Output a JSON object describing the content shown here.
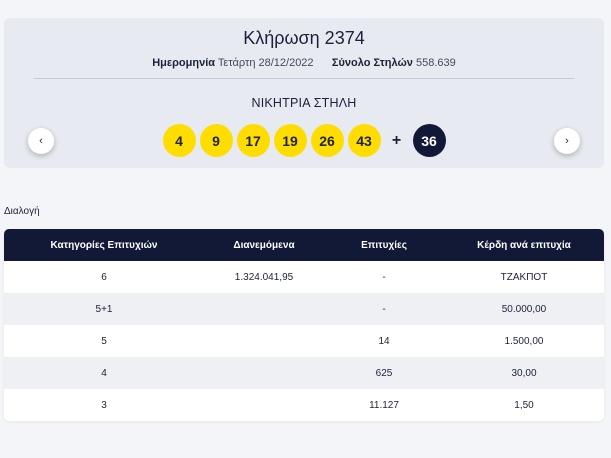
{
  "draw": {
    "title": "Κλήρωση 2374",
    "date_label": "Ημερομηνία",
    "date_value": "Τετάρτη 28/12/2022",
    "total_label": "Σύνολο Στηλών",
    "total_value": "558.639",
    "winning_label": "ΝΙΚΗΤΡΙΑ ΣΤΗΛΗ",
    "numbers": [
      "4",
      "9",
      "17",
      "19",
      "26",
      "43"
    ],
    "plus": "+",
    "joker": "36",
    "prev_icon": "‹",
    "next_icon": "›"
  },
  "select_label": "Διαλογή",
  "table": {
    "headers": [
      "Κατηγορίες Επιτυχιών",
      "Διανεμόμενα",
      "Επιτυχίες",
      "Κέρδη ανά επιτυχία"
    ],
    "rows": [
      [
        "6",
        "1.324.041,95",
        "-",
        "ΤΖΑΚΠΟΤ"
      ],
      [
        "5+1",
        "",
        "-",
        "50.000,00"
      ],
      [
        "5",
        "",
        "14",
        "1.500,00"
      ],
      [
        "4",
        "",
        "625",
        "30,00"
      ],
      [
        "3",
        "",
        "11.127",
        "1,50"
      ]
    ]
  },
  "colors": {
    "ball": "#ffdd00",
    "joker": "#111936",
    "header": "#111936"
  }
}
